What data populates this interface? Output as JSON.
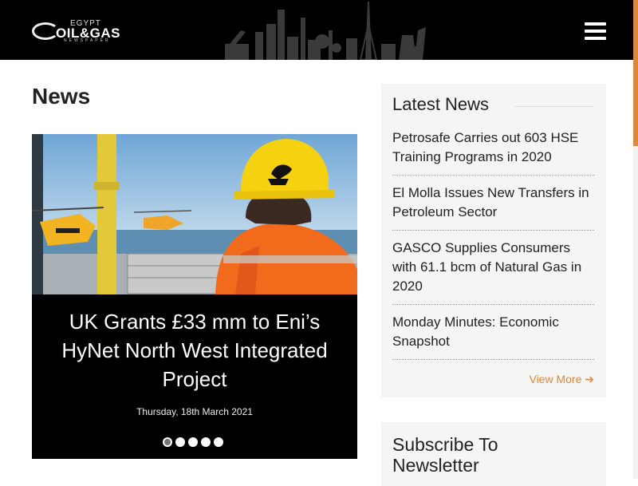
{
  "header": {
    "logo": {
      "top": "EGYPT",
      "main": "OIL&GAS",
      "sub": "NEWSPAPER"
    },
    "menu_icon": "hamburger-icon"
  },
  "main": {
    "title": "News",
    "slider": {
      "caption": "UK Grants £33 mm to Eni’s HyNet North West Integrated Project",
      "date": "Thursday, 18th March 2021",
      "slide_count": 5,
      "active_slide": 1
    }
  },
  "sidebar": {
    "latest_title": "Latest News",
    "items": [
      {
        "title": "Petrosafe Carries out 603 HSE Training Programs in 2020"
      },
      {
        "title": "El Molla Issues New Transfers in Petroleum Sector"
      },
      {
        "title": "GASCO Supplies Consumers with 61.1 bcm of Natural Gas in 2020"
      },
      {
        "title": "Monday Minutes: Economic Snapshot"
      }
    ],
    "view_more": "View More",
    "subscribe_title": "Subscribe To Newsletter"
  },
  "colors": {
    "accent": "#e8862e",
    "header_bg": "#000000",
    "sidebar_bg": "#f5f5f5"
  }
}
